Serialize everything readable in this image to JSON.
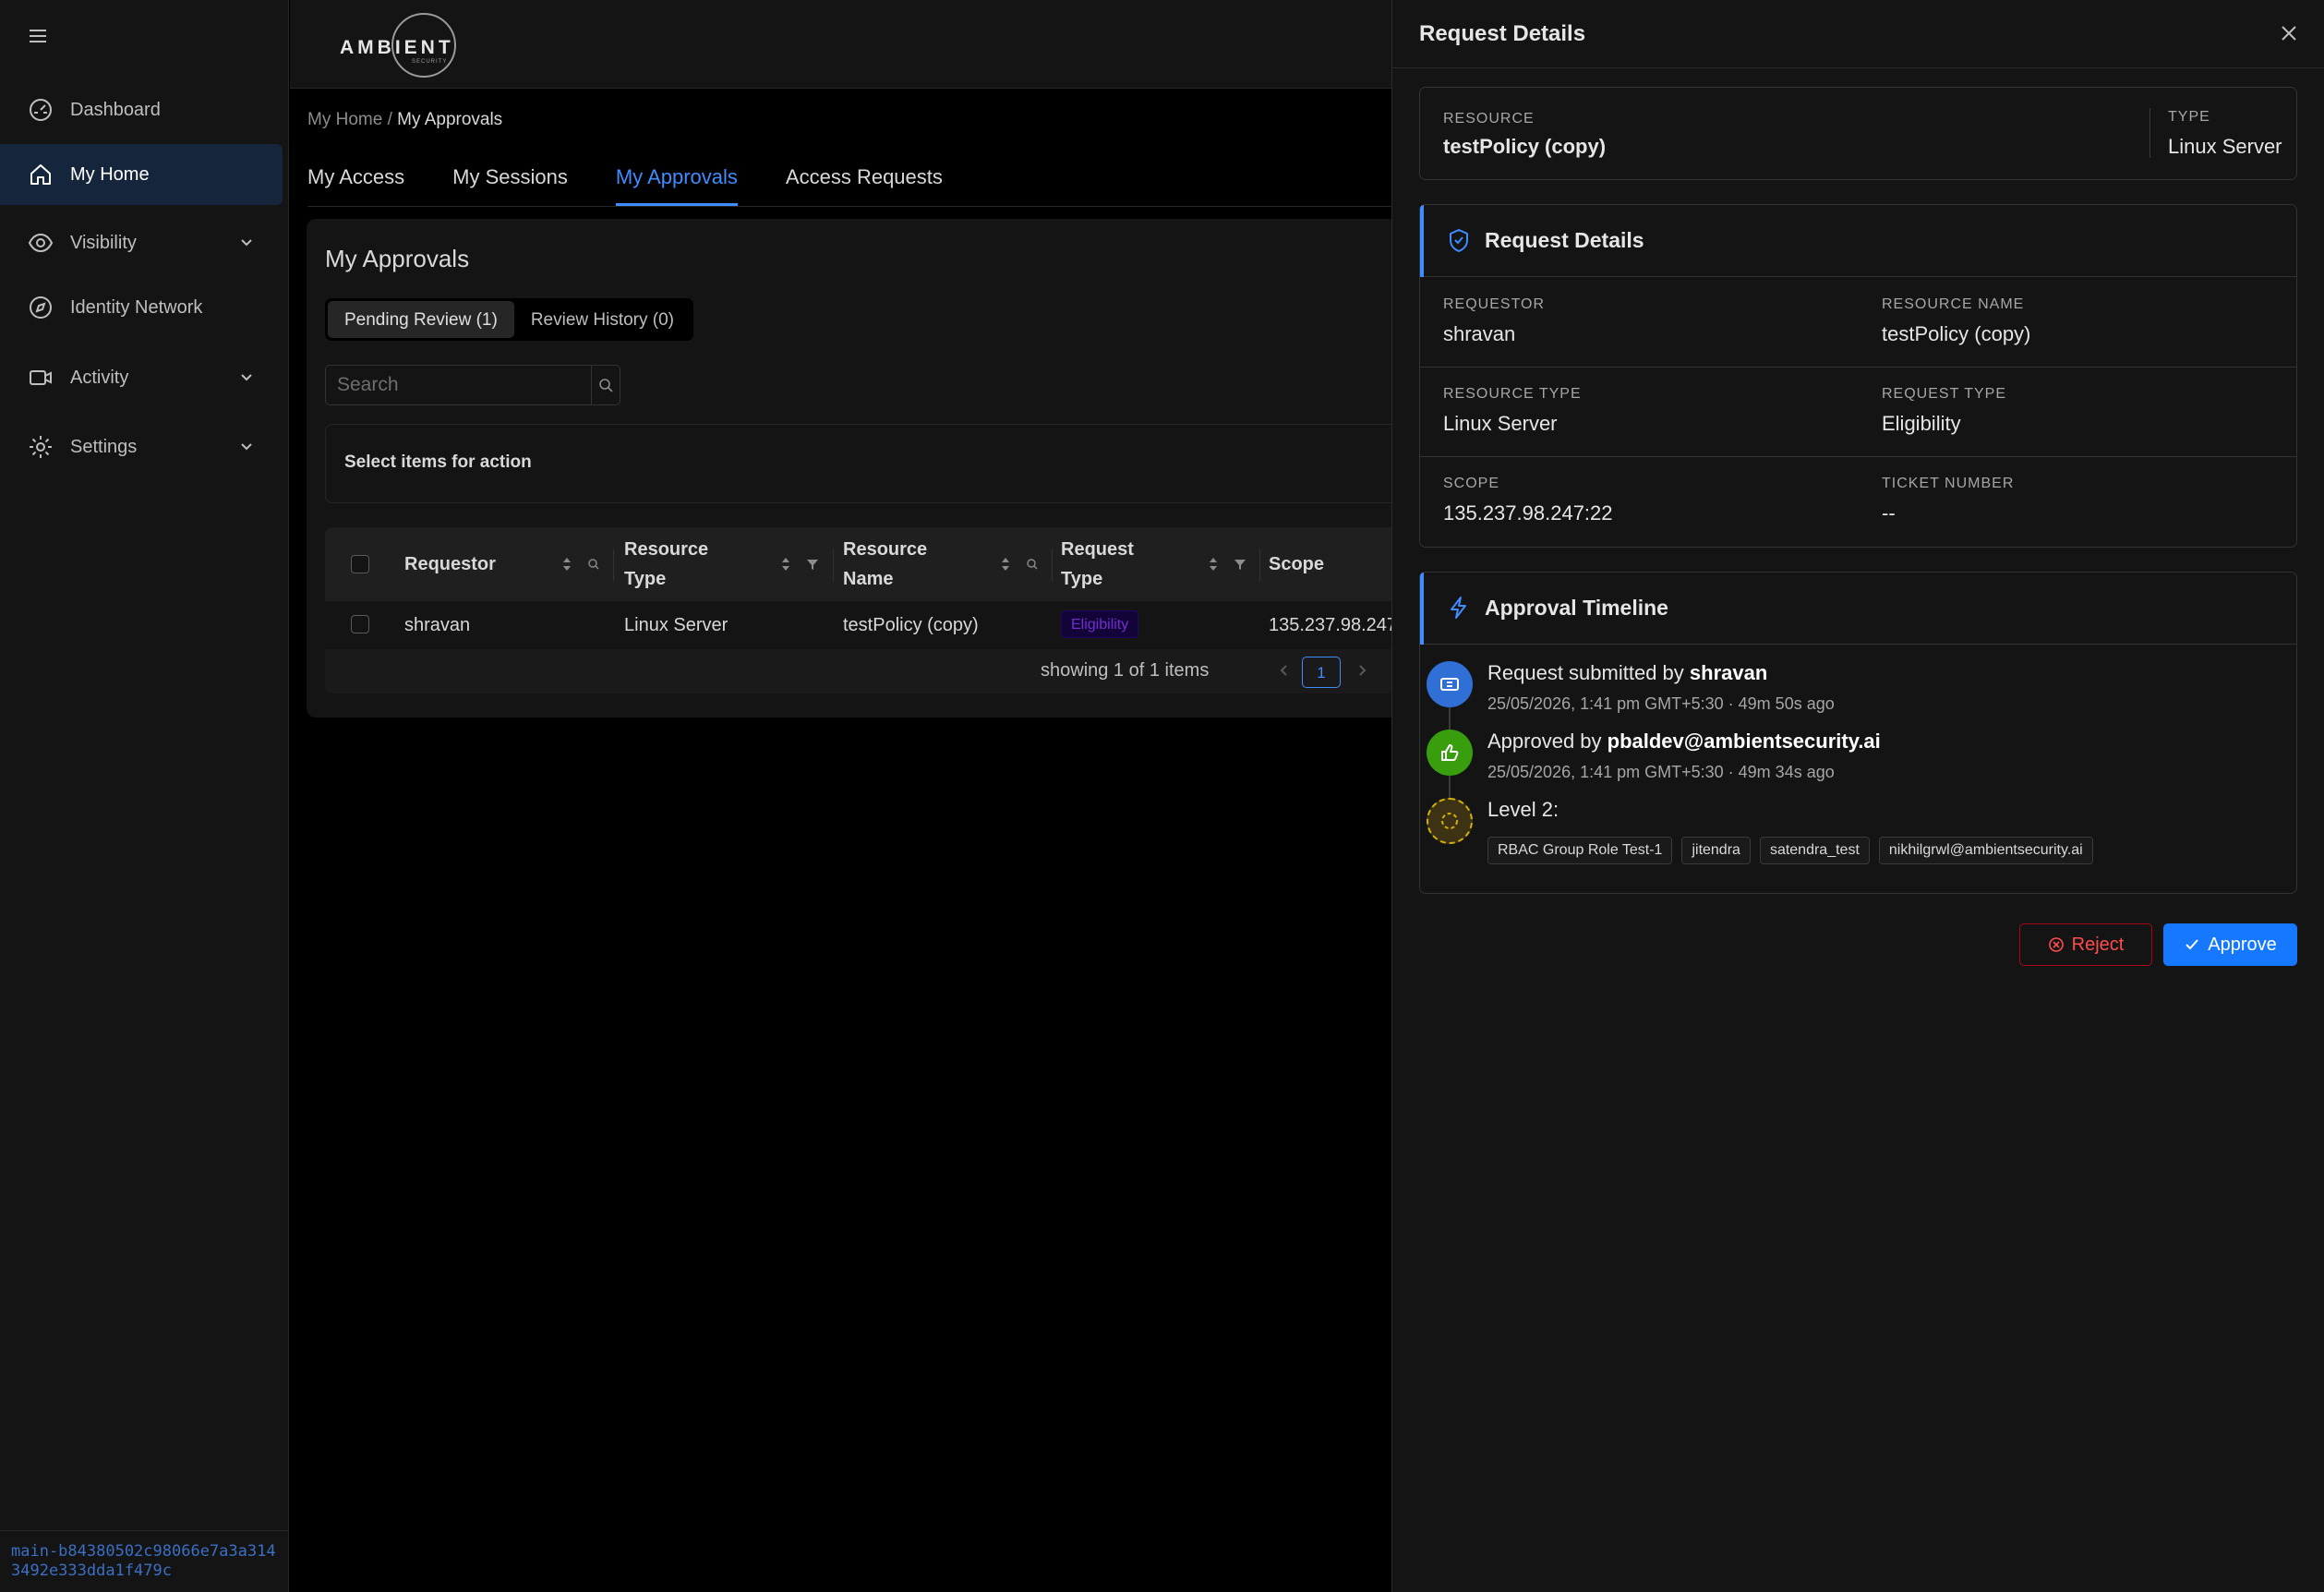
{
  "sidebar": {
    "items": [
      {
        "label": "Dashboard",
        "icon": "dashboard-icon"
      },
      {
        "label": "My Home",
        "icon": "home-icon",
        "active": true
      },
      {
        "label": "Visibility",
        "icon": "eye-icon",
        "expandable": true
      },
      {
        "label": "Identity Network",
        "icon": "compass-icon"
      },
      {
        "label": "Activity",
        "icon": "activity-icon",
        "expandable": true
      },
      {
        "label": "Settings",
        "icon": "gear-icon",
        "expandable": true
      }
    ],
    "build_hash": "main-b84380502c98066e7a3a3143492e333dda1f479c"
  },
  "header": {
    "logo_text": "AMBIENT",
    "logo_sub": "SECURITY"
  },
  "breadcrumb": {
    "root": "My Home",
    "separator": " / ",
    "current": "My Approvals"
  },
  "tabs": [
    {
      "label": "My Access"
    },
    {
      "label": "My Sessions"
    },
    {
      "label": "My Approvals",
      "active": true
    },
    {
      "label": "Access Requests"
    }
  ],
  "approvals": {
    "title": "My Approvals",
    "segments": [
      {
        "label": "Pending Review (1)",
        "active": true
      },
      {
        "label": "Review History (0)"
      }
    ],
    "search_placeholder": "Search",
    "action_text": "Select items for action",
    "columns": {
      "requestor": "Requestor",
      "resource_type": "Resource Type",
      "resource_name": "Resource Name",
      "request_type": "Request Type",
      "scope": "Scope"
    },
    "rows": [
      {
        "requestor": "shravan",
        "resource_type": "Linux Server",
        "resource_name": "testPolicy (copy)",
        "request_type": "Eligibility",
        "scope": "135.237.98.247"
      }
    ],
    "pagination": {
      "showing": "showing 1 of 1 items",
      "page": "1"
    }
  },
  "drawer": {
    "title": "Request Details",
    "resource": {
      "label": "RESOURCE",
      "value": "testPolicy (copy)",
      "type_label": "TYPE",
      "type_value": "Linux Server"
    },
    "details": {
      "title": "Request Details",
      "requestor_label": "REQUESTOR",
      "requestor": "shravan",
      "resource_name_label": "RESOURCE NAME",
      "resource_name": "testPolicy (copy)",
      "resource_type_label": "RESOURCE TYPE",
      "resource_type": "Linux Server",
      "request_type_label": "REQUEST TYPE",
      "request_type": "Eligibility",
      "scope_label": "SCOPE",
      "scope": "135.237.98.247:22",
      "ticket_label": "TICKET NUMBER",
      "ticket": "--"
    },
    "timeline": {
      "title": "Approval Timeline",
      "submitted_prefix": "Request submitted by ",
      "submitted_by": "shravan",
      "submitted_time": "25/05/2026, 1:41 pm GMT+5:30 · 49m 50s ago",
      "approved_prefix": "Approved by ",
      "approved_by": "pbaldev@ambientsecurity.ai",
      "approved_time": "25/05/2026, 1:41 pm GMT+5:30 · 49m 34s ago",
      "level_label": "Level 2:",
      "level_approvers": [
        "RBAC Group Role Test-1",
        "jitendra",
        "satendra_test",
        "nikhilgrwl@ambientsecurity.ai"
      ]
    },
    "buttons": {
      "reject": "Reject",
      "approve": "Approve"
    }
  },
  "colors": {
    "accent": "#3f8cff",
    "approve_bg": "#1677ff",
    "reject": "#ff4d4f",
    "success": "#52c41a",
    "pending": "#d4b106",
    "eligibility_badge": "#722ed1"
  }
}
